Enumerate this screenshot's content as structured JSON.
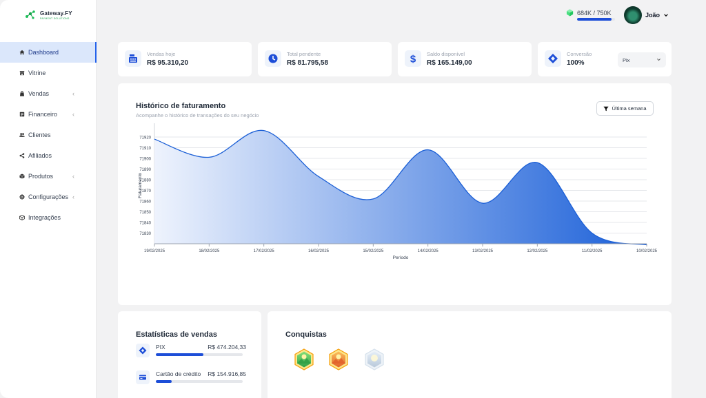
{
  "brand": {
    "name": "Gateway.FY",
    "tagline": "PAYMENT SOLUTIONS"
  },
  "sidebar": {
    "items": [
      {
        "label": "Dashboard",
        "icon": "home-icon",
        "active": true,
        "chevron": false
      },
      {
        "label": "Vitrine",
        "icon": "store-icon",
        "active": false,
        "chevron": false
      },
      {
        "label": "Vendas",
        "icon": "bag-icon",
        "active": false,
        "chevron": true
      },
      {
        "label": "Financeiro",
        "icon": "wallet-icon",
        "active": false,
        "chevron": true
      },
      {
        "label": "Clientes",
        "icon": "users-icon",
        "active": false,
        "chevron": false
      },
      {
        "label": "Afiliados",
        "icon": "share-icon",
        "active": false,
        "chevron": false
      },
      {
        "label": "Produtos",
        "icon": "box-icon",
        "active": false,
        "chevron": true
      },
      {
        "label": "Configurações",
        "icon": "gear-icon",
        "active": false,
        "chevron": true
      },
      {
        "label": "Integrações",
        "icon": "cube-icon",
        "active": false,
        "chevron": false
      }
    ],
    "chevron_glyph": "‹"
  },
  "header": {
    "xp_text": "684K  /  750K",
    "xp_progress": 0.912,
    "user_name": "João"
  },
  "stats": [
    {
      "label": "Vendas hoje",
      "value": "R$ 95.310,20",
      "icon": "cash-register-icon"
    },
    {
      "label": "Total pendente",
      "value": "R$ 81.795,58",
      "icon": "clock-icon"
    },
    {
      "label": "Saldo disponível",
      "value": "R$ 165.149,00",
      "icon": "dollar-icon"
    },
    {
      "label": "Conversão",
      "value": "100%",
      "icon": "pix-icon",
      "select": "Pix"
    }
  ],
  "history": {
    "title": "Histórico de faturamento",
    "subtitle": "Acompanhe o histórico de transações do seu negócio",
    "filter_label": "Última semana"
  },
  "chart_data": {
    "type": "area",
    "title": "",
    "xlabel": "Período",
    "ylabel": "Faturamento",
    "categories": [
      "19/02/2025",
      "18/02/2025",
      "17/02/2025",
      "16/02/2025",
      "15/02/2025",
      "14/02/2025",
      "13/02/2025",
      "12/02/2025",
      "11/02/2025",
      "10/02/2025"
    ],
    "values": [
      71918,
      71901,
      71926,
      71883,
      71862,
      71908,
      71858,
      71896,
      71830,
      71819
    ],
    "yticks": [
      71920,
      71910,
      71900,
      71890,
      71880,
      71870,
      71860,
      71850,
      71840,
      71830
    ],
    "ylim": [
      71820,
      71929
    ],
    "grid": true,
    "colors": {
      "start": "#eef3fd",
      "end": "#1a5fd8",
      "line": "#1b5fd6"
    }
  },
  "sales_stats": {
    "title": "Estatísticas de vendas",
    "rows": [
      {
        "name": "PIX",
        "value": "R$ 474.204,33",
        "progress": 0.55,
        "icon": "pix-icon"
      },
      {
        "name": "Cartão de crédito",
        "value": "R$ 154.916,85",
        "progress": 0.18,
        "icon": "credit-card-icon"
      }
    ]
  },
  "achievements": {
    "title": "Conquistas",
    "badges": [
      {
        "icon": "badge-green-icon",
        "colors": [
          "#86e07a",
          "#2f9e44"
        ]
      },
      {
        "icon": "badge-orange-icon",
        "colors": [
          "#fbbf5a",
          "#e0602b"
        ]
      },
      {
        "icon": "badge-locked-icon",
        "colors": [
          "#e5eef8",
          "#b9c9da"
        ]
      }
    ]
  }
}
